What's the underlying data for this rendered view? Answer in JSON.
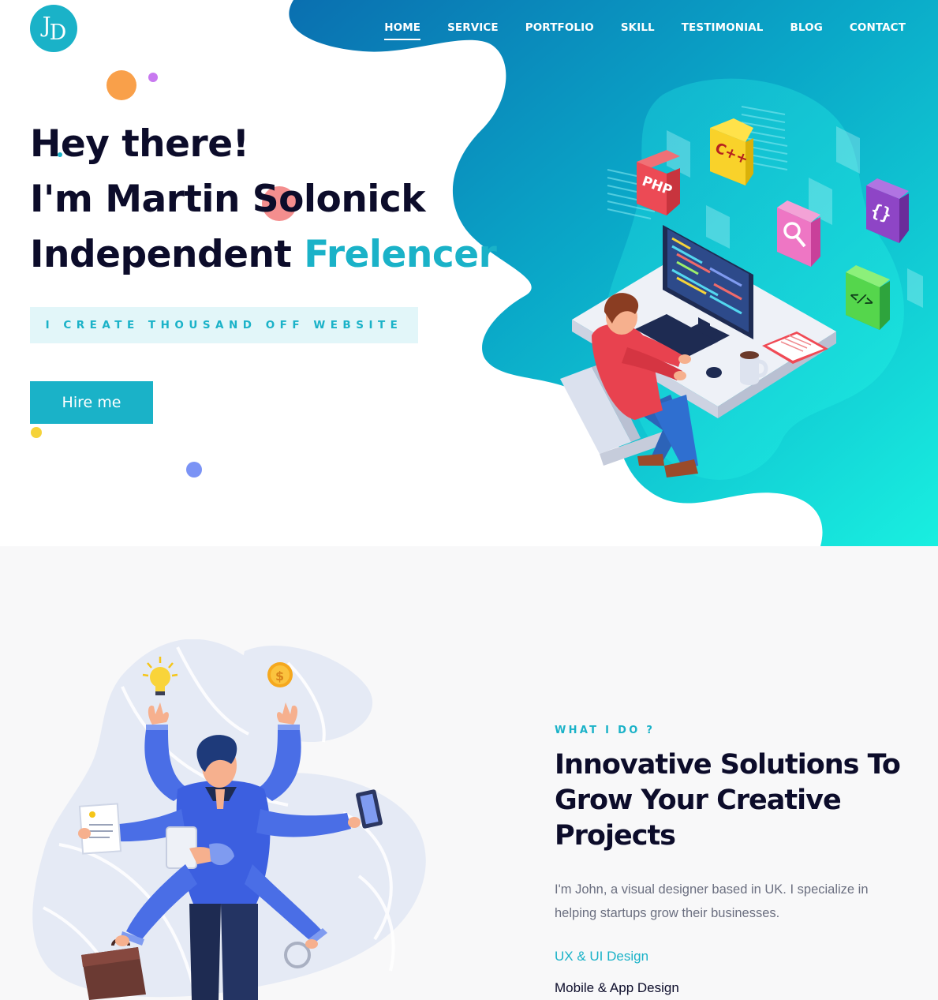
{
  "logo": {
    "letter_1": "J",
    "letter_2": "D"
  },
  "nav": {
    "items": [
      {
        "label": "HOME",
        "active": true
      },
      {
        "label": "SERVICE"
      },
      {
        "label": "PORTFOLIO"
      },
      {
        "label": "SKILL"
      },
      {
        "label": "TESTIMONIAL"
      },
      {
        "label": "BLOG"
      },
      {
        "label": "CONTACT"
      }
    ]
  },
  "hero": {
    "line_1": "Hey there!",
    "line_2": "I'm Martin Solonick",
    "line_3_prefix": "Independent ",
    "line_3_accent": "Frelencer",
    "tagline": "I CREATE THOUSAND OFF WEBSITE",
    "cta_label": "Hire me",
    "badges": [
      "PHP",
      "C++",
      "{}",
      "</>"
    ]
  },
  "service": {
    "eyebrow": "WHAT I DO ?",
    "title_lines": [
      "Innovative Solutions To",
      "Grow Your Creative",
      "Projects"
    ],
    "description": "I'm John, a visual designer based in UK. I specialize in helping startups grow their businesses.",
    "skills": [
      "UX & UI Design",
      "Mobile & App Design"
    ],
    "coin_symbol": "$"
  },
  "colors": {
    "accent": "#1ab2c8",
    "dark": "#0c0c2a",
    "tagline_bg": "#e2f6f9",
    "service_bg": "#f8f8f9"
  },
  "icons": [
    "bulb-icon",
    "coin-icon",
    "briefcase-icon",
    "magnifier-icon",
    "phone-icon",
    "document-icon",
    "tablet-icon"
  ]
}
